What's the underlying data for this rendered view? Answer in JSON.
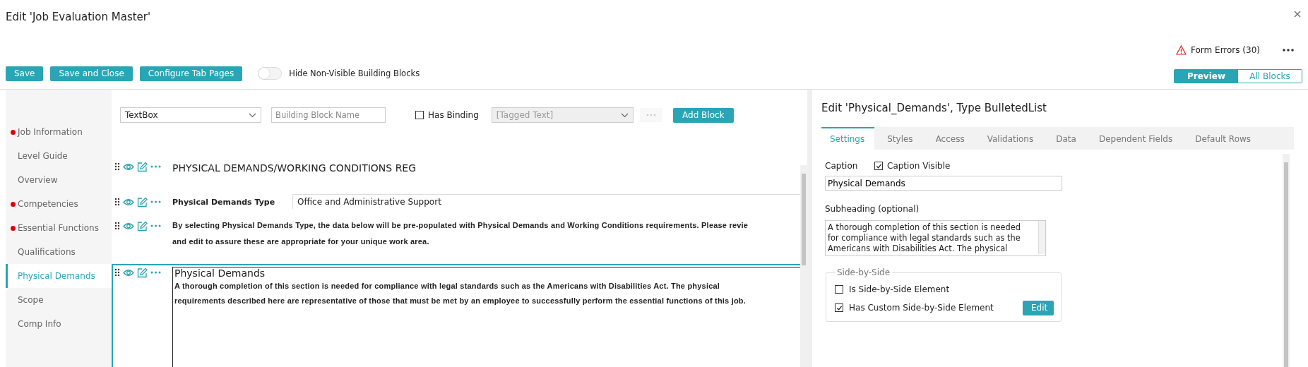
{
  "window": {
    "title": "Edit 'Job Evaluation Master'"
  },
  "header": {
    "form_errors": "Form Errors (30)"
  },
  "toolbar": {
    "buttons": [
      "Save",
      "Save and Close",
      "Configure Tab Pages"
    ],
    "toggle": {
      "label": "Hide Non-Visible Building Blocks",
      "on": false
    }
  },
  "view_switch": [
    {
      "label": "Preview",
      "selected": true
    },
    {
      "label": "All Blocks",
      "selected": false
    }
  ],
  "sidebar": {
    "items": [
      {
        "label": "Job Information",
        "error": true,
        "selected": false
      },
      {
        "label": "Level Guide",
        "error": false,
        "selected": false
      },
      {
        "label": "Overview",
        "error": false,
        "selected": false
      },
      {
        "label": "Competencies",
        "error": true,
        "selected": false
      },
      {
        "label": "Essential Functions",
        "error": true,
        "selected": false
      },
      {
        "label": "Qualifications",
        "error": false,
        "selected": false
      },
      {
        "label": "Physical Demands",
        "error": false,
        "selected": true
      },
      {
        "label": "Scope",
        "error": false,
        "selected": false
      },
      {
        "label": "Comp Info",
        "error": false,
        "selected": false
      }
    ]
  },
  "block_toolbar": {
    "type_select": "TextBox",
    "name_field": {
      "placeholder": "Building Block Name"
    },
    "has_binding": {
      "label": "Has Binding",
      "checked": false
    },
    "binding_select": {
      "placeholder": "[Tagged Text]",
      "disabled": true
    },
    "add_button": "Add Block"
  },
  "blocks": [
    {
      "kind": "heading",
      "selected": false,
      "text": "PHYSICAL DEMANDS/WORKING CONDITIONS REG"
    },
    {
      "kind": "field",
      "selected": false,
      "label": "Physical Demands Type",
      "value": "Office and Administrative Support"
    },
    {
      "kind": "paragraph",
      "selected": false,
      "lines": [
        "By selecting Physical Demands Type, the data below will be pre-populated with Physical Demands and Working Conditions requirements. Please revie",
        "and edit to assure these are appropriate for your unique work area."
      ]
    },
    {
      "kind": "list",
      "selected": true,
      "caption": "Physical Demands",
      "lines": [
        "A thorough completion of this section is needed for compliance with legal standards such as the Americans with Disabilities Act. The physical",
        "requirements described here are representative of those that must be met by an employee to successfully perform the essential functions of this job."
      ]
    }
  ],
  "editor": {
    "title": "Edit 'Physical_Demands', Type BulletedList",
    "tabs": [
      {
        "label": "Settings",
        "selected": true
      },
      {
        "label": "Styles",
        "selected": false
      },
      {
        "label": "Access",
        "selected": false
      },
      {
        "label": "Validations",
        "selected": false
      },
      {
        "label": "Data",
        "selected": false
      },
      {
        "label": "Dependent Fields",
        "selected": false
      },
      {
        "label": "Default Rows",
        "selected": false
      }
    ],
    "caption_label": "Caption",
    "caption_visible": {
      "label": "Caption Visible",
      "checked": true
    },
    "caption_value": "Physical Demands",
    "subheading_label": "Subheading (optional)",
    "subheading_value": "A thorough completion of this section is needed for compliance with legal standards such as the Americans with Disabilities Act. The physical",
    "side_by_side": {
      "legend": "Side-by-Side",
      "options": [
        {
          "label": "Is Side-by-Side Element",
          "checked": false
        },
        {
          "label": "Has Custom Side-by-Side Element",
          "checked": true,
          "button": "Edit"
        }
      ]
    }
  }
}
